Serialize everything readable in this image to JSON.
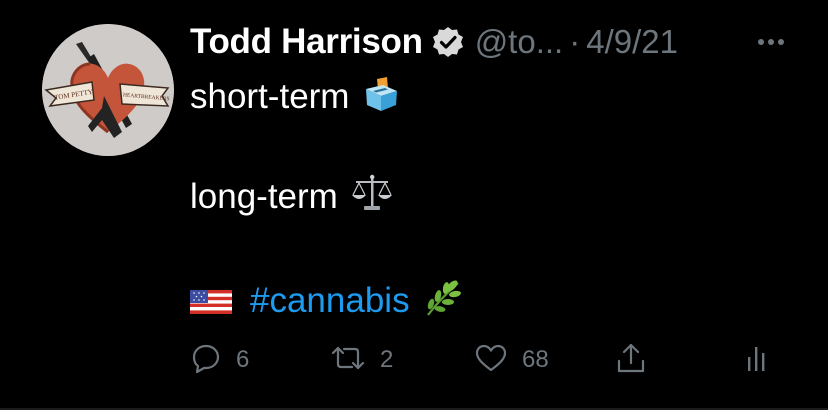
{
  "tweet": {
    "author_name": "Todd Harrison",
    "handle": "@to...",
    "separator": "·",
    "date": "4/9/21",
    "lines": {
      "line1": "short-term",
      "line2": "long-term",
      "hashtag": "#cannabis"
    },
    "actions": {
      "reply_count": "6",
      "retweet_count": "2",
      "like_count": "68"
    }
  },
  "avatar_text": {
    "left": "TOM PETTY",
    "right": "HEARTBREAKERS"
  },
  "colors": {
    "background": "#000000",
    "text": "#ffffff",
    "muted": "#6e767d",
    "link": "#1d9bf0"
  },
  "icons": {
    "verified": "verified-badge-icon",
    "more": "more-options-icon",
    "ballot": "ballot-box-icon",
    "scales": "balance-scale-icon",
    "flag": "us-flag-icon",
    "herb": "herb-icon",
    "reply": "reply-icon",
    "retweet": "retweet-icon",
    "like": "like-icon",
    "share": "share-icon",
    "analytics": "analytics-icon"
  }
}
